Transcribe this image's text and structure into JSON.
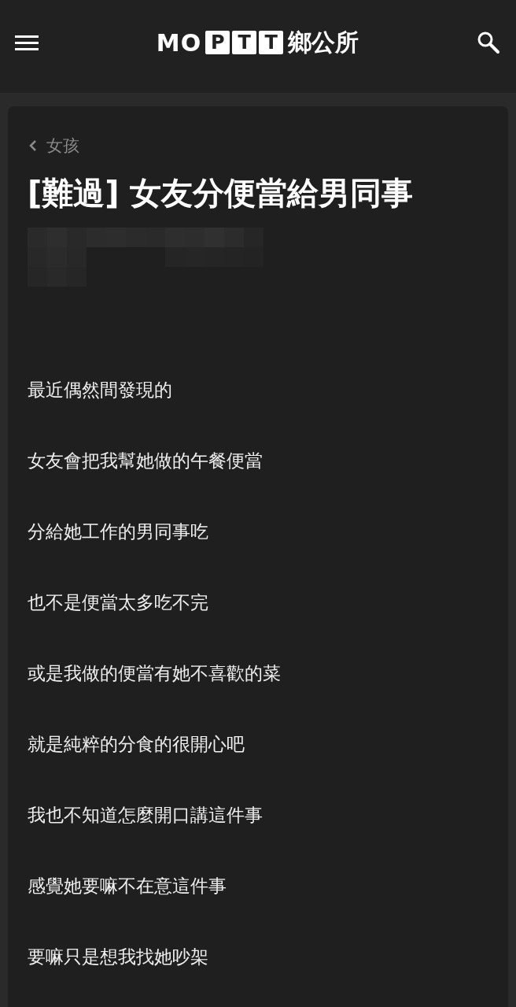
{
  "header": {
    "logo": {
      "prefix": "MO",
      "boxed_letters": [
        "P",
        "T",
        "T"
      ],
      "suffix": "鄉公所"
    }
  },
  "article": {
    "board": "女孩",
    "title": "[難過] 女友分便當給男同事",
    "paragraphs": [
      "最近偶然間發現的",
      "女友會把我幫她做的午餐便當",
      "分給她工作的男同事吃",
      "也不是便當太多吃不完",
      "或是我做的便當有她不喜歡的菜",
      "就是純粹的分食的很開心吧",
      "我也不知道怎麼開口講這件事",
      "感覺她要嘛不在意這件事",
      "要嘛只是想我找她吵架"
    ]
  }
}
